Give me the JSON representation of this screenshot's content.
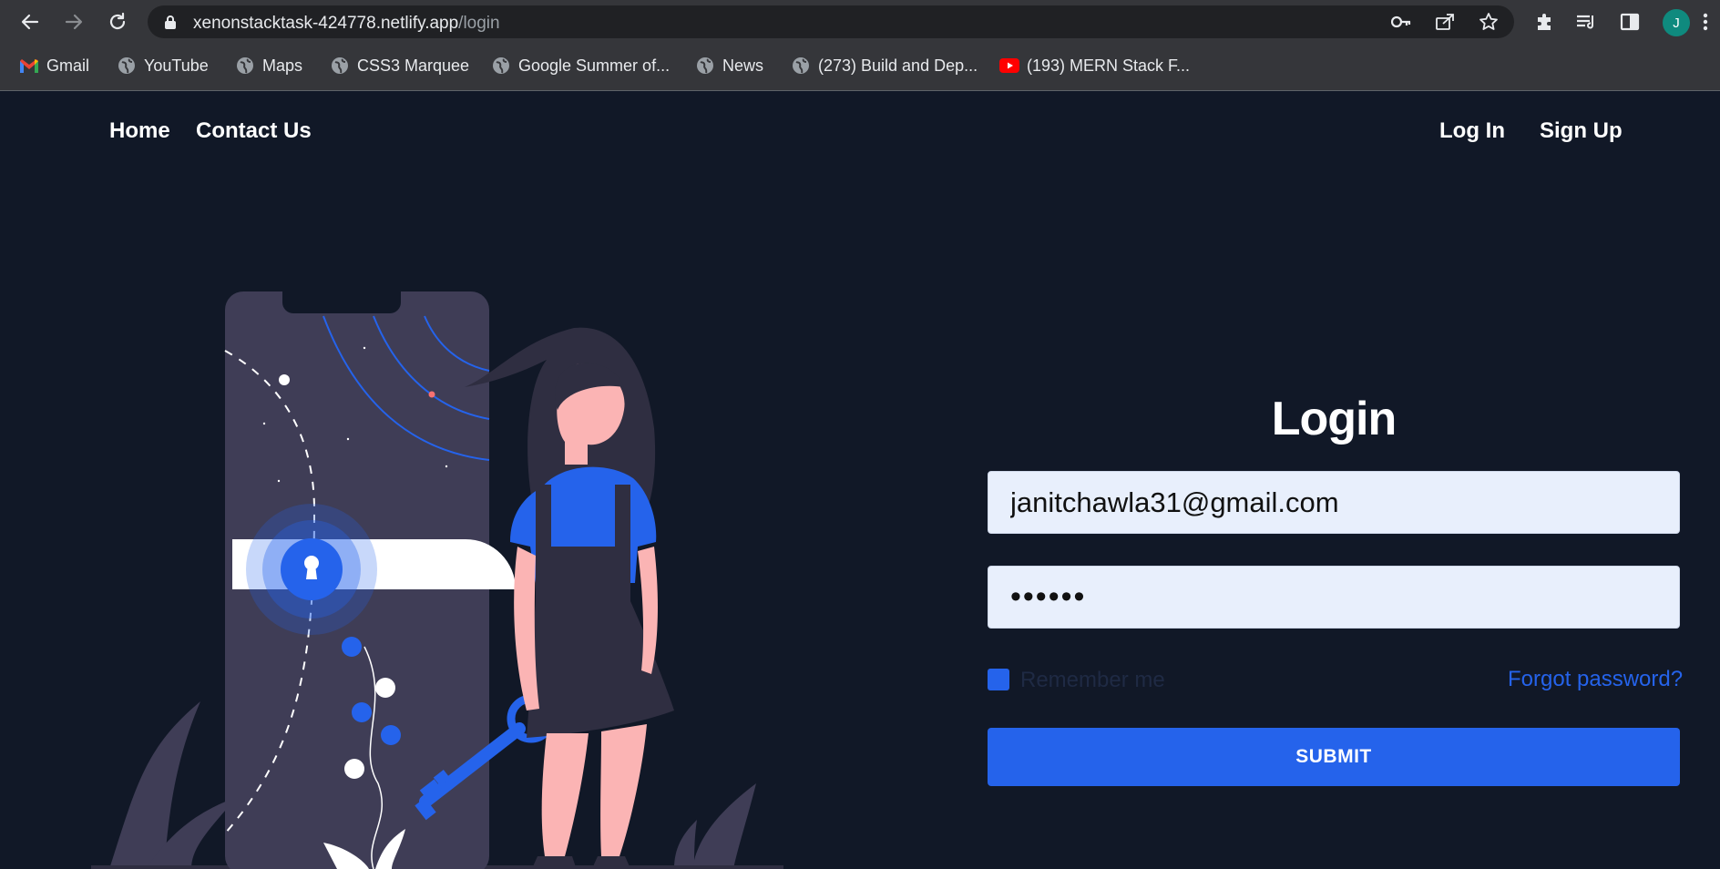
{
  "browser": {
    "url_domain": "xenonstacktask-424778.netlify.app",
    "url_path": "/login",
    "profile_initial": "J",
    "bookmarks": [
      {
        "label": "Gmail",
        "icon": "gmail-icon"
      },
      {
        "label": "YouTube",
        "icon": "globe-icon"
      },
      {
        "label": "Maps",
        "icon": "globe-icon"
      },
      {
        "label": "CSS3 Marquee",
        "icon": "globe-icon"
      },
      {
        "label": "Google Summer of...",
        "icon": "globe-icon"
      },
      {
        "label": "News",
        "icon": "globe-icon"
      },
      {
        "label": "(273) Build and Dep...",
        "icon": "globe-icon"
      },
      {
        "label": "(193) MERN Stack F...",
        "icon": "youtube-icon"
      }
    ]
  },
  "nav": {
    "home": "Home",
    "contact": "Contact Us",
    "login": "Log In",
    "signup": "Sign Up"
  },
  "login": {
    "title": "Login",
    "email_value": "janitchawla31@gmail.com",
    "password_value": "••••••",
    "remember_label": "Remember me",
    "forgot_label": "Forgot password?",
    "submit_label": "SUBMIT"
  },
  "colors": {
    "page_bg": "#111827",
    "accent": "#2563eb",
    "input_bg": "#e8effc"
  }
}
